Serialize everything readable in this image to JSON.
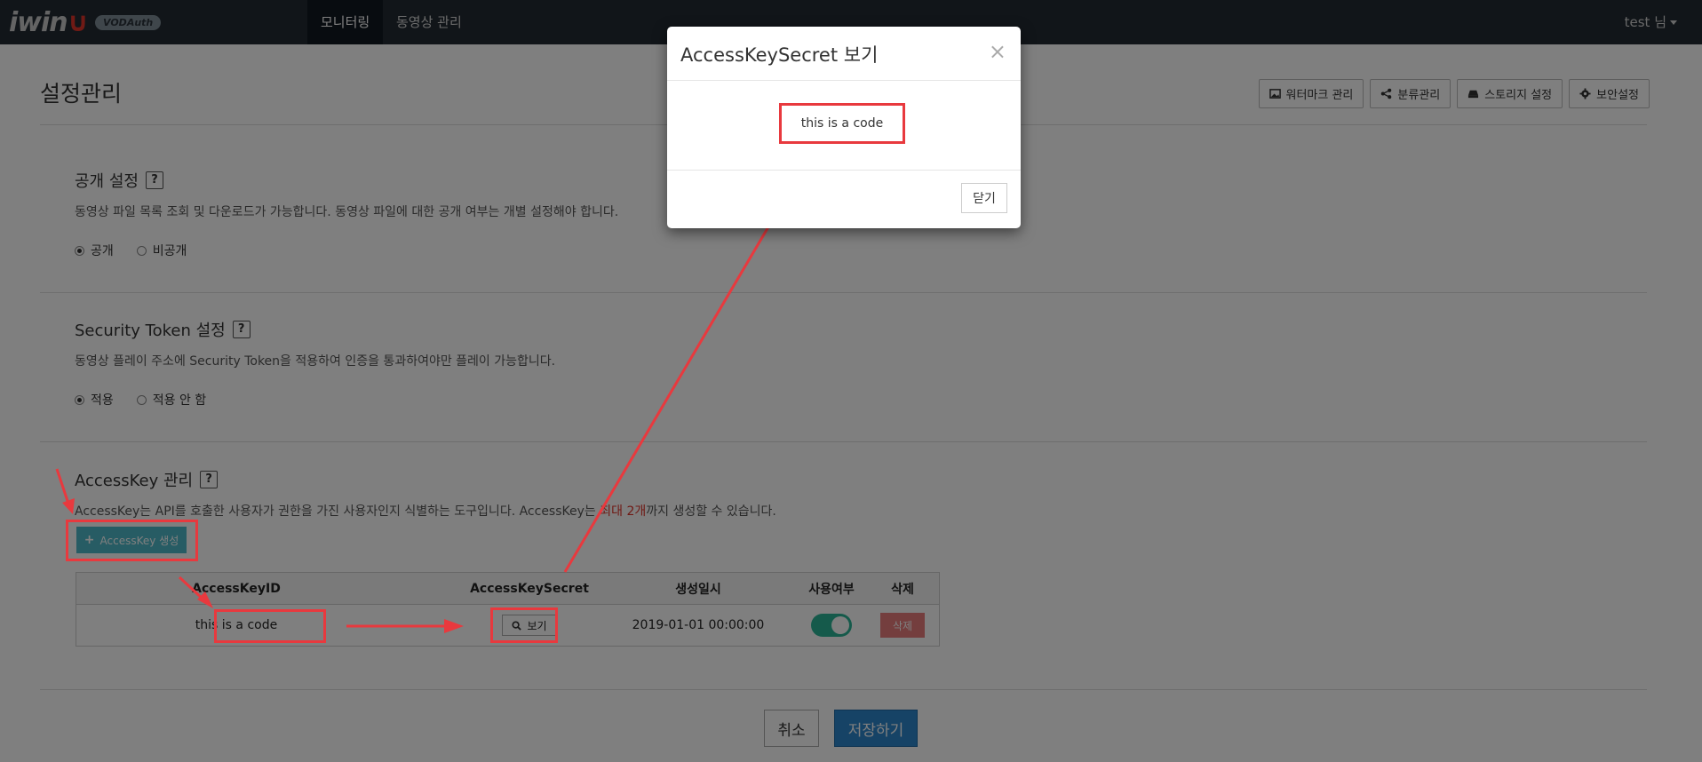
{
  "navbar": {
    "logo_text": "iwin",
    "logo_badge": "VODAuth",
    "tabs": [
      "모니터링",
      "동영상 관리"
    ],
    "user": "test 님"
  },
  "page": {
    "title": "설정관리",
    "actions": [
      "워터마크 관리",
      "분류관리",
      "스토리지 설정",
      "보안설정"
    ]
  },
  "public_section": {
    "title": "공개 설정",
    "help": "?",
    "desc": "동영상 파일 목록 조회 및 다운로드가 가능합니다. 동영상 파일에 대한 공개 여부는 개별 설정해야 합니다.",
    "options": [
      "공개",
      "비공개"
    ],
    "selected": "공개"
  },
  "token_section": {
    "title": "Security Token 설정",
    "help": "?",
    "desc": "동영상 플레이 주소에 Security Token을 적용하여 인증을 통과하여야만 플레이 가능합니다.",
    "options": [
      "적용",
      "적용 안 함"
    ],
    "selected": "적용"
  },
  "accesskey_section": {
    "title": "AccessKey 관리",
    "help": "?",
    "desc_a": "AccessKey는 API를 호출한 사용자가 권한을 가진 사용자인지 식별하는 도구입니다. AccessKey는 ",
    "desc_red": "최대 2개",
    "desc_b": "까지 생성할 수 있습니다.",
    "create_label": "AccessKey 생성",
    "table": {
      "headers": [
        "AccessKeyID",
        "AccessKeySecret",
        "생성일시",
        "사용여부",
        "삭제"
      ],
      "row": {
        "id": "this is a code",
        "view_label": "보기",
        "created": "2019-01-01 00:00:00",
        "enabled": true,
        "delete_label": "삭제"
      }
    }
  },
  "footer": {
    "cancel": "취소",
    "save": "저장하기"
  },
  "modal": {
    "title": "AccessKeySecret 보기",
    "close_x": "×",
    "code": "this is a code",
    "close_label": "닫기"
  },
  "colors": {
    "navbar": "#222b33",
    "highlight": "#e8393e",
    "primary": "#2c86cc",
    "create": "#4fb9c8",
    "toggle_on": "#2bb596"
  }
}
